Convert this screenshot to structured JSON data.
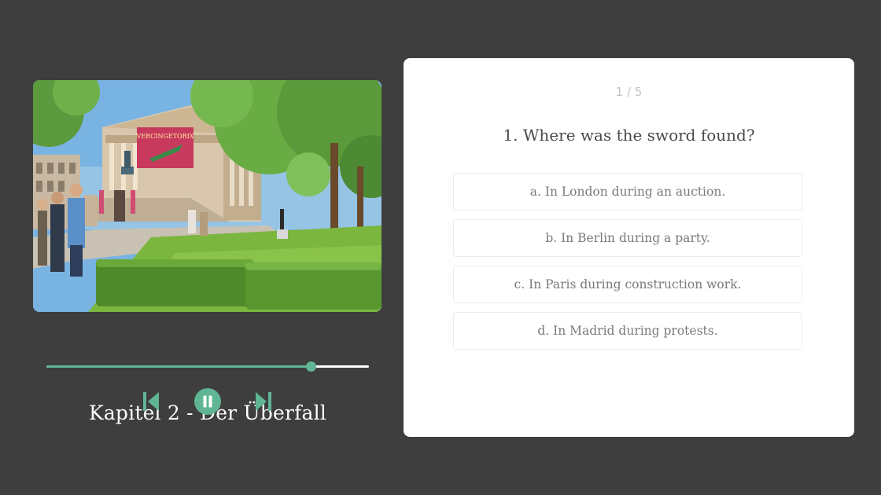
{
  "player": {
    "cover_alt": "Museum courtyard illustration",
    "banner_text": "VERCINGETORIX",
    "chapter_title": "Kapitel 2 - Der Überfall",
    "progress_fraction": 0.82,
    "accent_color": "#5fb594",
    "controls": {
      "prev_icon": "skip-previous-icon",
      "pause_icon": "pause-icon",
      "next_icon": "skip-next-icon"
    }
  },
  "quiz": {
    "progress": "1 / 5",
    "question": "1. Where was the sword found?",
    "answers": [
      "a. In London during an auction.",
      "b. In Berlin during a party.",
      "c. In Paris during construction work.",
      "d. In Madrid during protests."
    ]
  }
}
